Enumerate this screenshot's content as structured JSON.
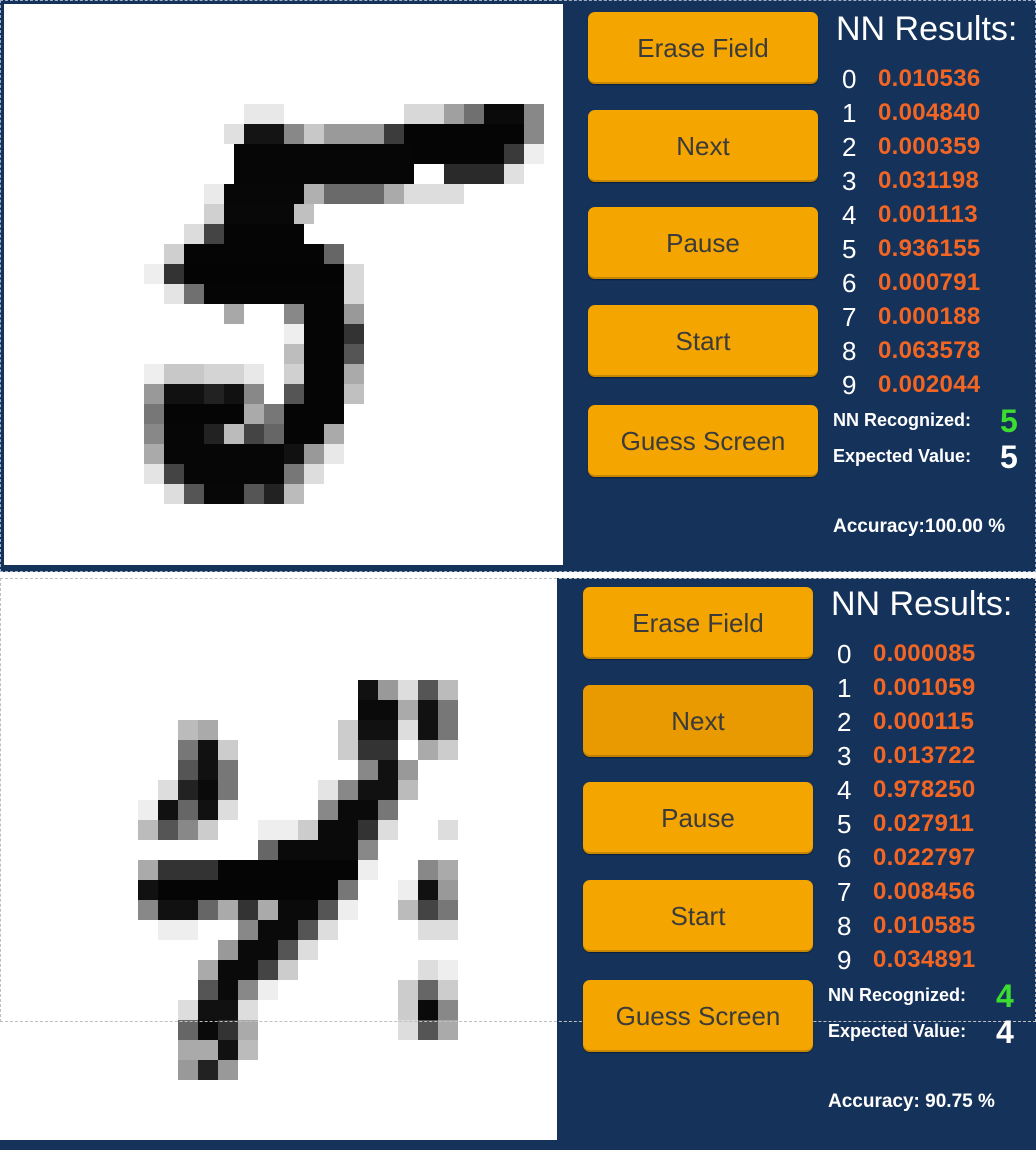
{
  "panels": [
    {
      "buttons": {
        "erase": "Erase Field",
        "next": "Next",
        "pause": "Pause",
        "start": "Start",
        "guess": "Guess Screen"
      },
      "results_title": "NN Results:",
      "results": [
        {
          "digit": "0",
          "prob": "0.010536"
        },
        {
          "digit": "1",
          "prob": "0.004840"
        },
        {
          "digit": "2",
          "prob": "0.000359"
        },
        {
          "digit": "3",
          "prob": "0.031198"
        },
        {
          "digit": "4",
          "prob": "0.001113"
        },
        {
          "digit": "5",
          "prob": "0.936155"
        },
        {
          "digit": "6",
          "prob": "0.000791"
        },
        {
          "digit": "7",
          "prob": "0.000188"
        },
        {
          "digit": "8",
          "prob": "0.063578"
        },
        {
          "digit": "9",
          "prob": "0.002044"
        }
      ],
      "recognized_label": "NN Recognized:",
      "recognized_value": "5",
      "expected_label": "Expected Value:",
      "expected_value": "5",
      "accuracy": "Accuracy:100.00 %"
    },
    {
      "buttons": {
        "erase": "Erase Field",
        "next": "Next",
        "pause": "Pause",
        "start": "Start",
        "guess": "Guess Screen"
      },
      "results_title": "NN Results:",
      "results": [
        {
          "digit": "0",
          "prob": "0.000085"
        },
        {
          "digit": "1",
          "prob": "0.001059"
        },
        {
          "digit": "2",
          "prob": "0.000115"
        },
        {
          "digit": "3",
          "prob": "0.013722"
        },
        {
          "digit": "4",
          "prob": "0.978250"
        },
        {
          "digit": "5",
          "prob": "0.027911"
        },
        {
          "digit": "6",
          "prob": "0.022797"
        },
        {
          "digit": "7",
          "prob": "0.008456"
        },
        {
          "digit": "8",
          "prob": "0.010585"
        },
        {
          "digit": "9",
          "prob": "0.034891"
        }
      ],
      "recognized_label": "NN Recognized:",
      "recognized_value": "4",
      "expected_label": "Expected Value:",
      "expected_value": "4",
      "accuracy": "Accuracy: 90.75 %"
    }
  ],
  "colors": {
    "panel_bg": "#15325a",
    "button": "#f5a500",
    "probability": "#f26522",
    "recognized": "#3ddc31"
  }
}
